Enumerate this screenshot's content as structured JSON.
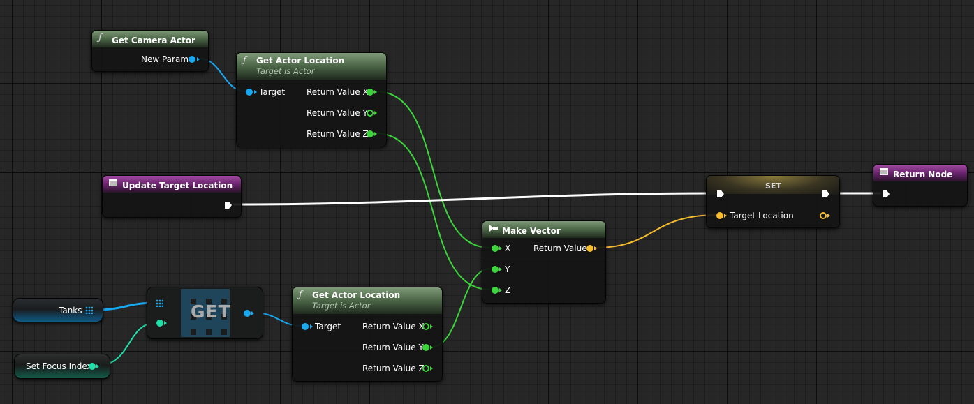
{
  "nodes": {
    "get_camera_actor": {
      "title": "Get Camera Actor",
      "icon": "function-icon",
      "outputs": [
        "New Param"
      ]
    },
    "get_actor_location_top": {
      "title": "Get Actor Location",
      "subtitle": "Target is Actor",
      "inputs": [
        "Target"
      ],
      "outputs": [
        "Return Value X",
        "Return Value Y",
        "Return Value Z"
      ]
    },
    "update_target_location": {
      "title": "Update Target Location",
      "icon": "event-icon"
    },
    "set": {
      "title": "SET",
      "inputs": [
        "Target Location"
      ]
    },
    "return_node": {
      "title": "Return Node",
      "icon": "event-icon"
    },
    "make_vector": {
      "title": "Make Vector",
      "icon": "make-struct-icon",
      "inputs": [
        "X",
        "Y",
        "Z"
      ],
      "outputs": [
        "Return Value"
      ]
    },
    "tanks": {
      "label": "Tanks"
    },
    "set_focus_index": {
      "label": "Set Focus Index"
    },
    "get": {
      "label": "GET"
    },
    "get_actor_location_bottom": {
      "title": "Get Actor Location",
      "subtitle": "Target is Actor",
      "inputs": [
        "Target"
      ],
      "outputs": [
        "Return Value X",
        "Return Value Y",
        "Return Value Z"
      ]
    }
  },
  "colors": {
    "background": "#262626",
    "float_pin": "#3bd43b",
    "object_pin": "#17a8f2",
    "integer_pin": "#1fe0a8",
    "vector_pin": "#f6bc2c",
    "exec_wire": "#ffffff",
    "function_header": "#5a7a55",
    "event_header": "#8a2f8a"
  }
}
